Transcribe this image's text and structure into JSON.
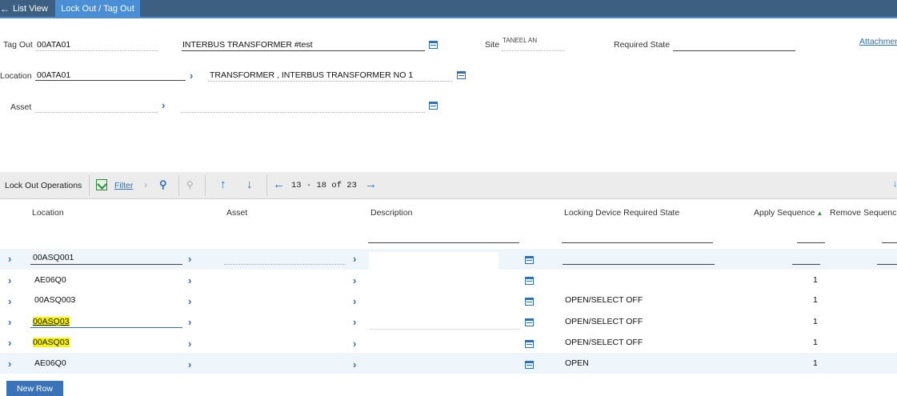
{
  "tabs": {
    "list_view": "List View",
    "active": "Lock Out / Tag Out"
  },
  "header": {
    "tag_out_label": "Tag Out",
    "tag_out_value": "00ATA01",
    "tag_out_desc": "INTERBUS TRANSFORMER #test",
    "site_label": "Site",
    "site_value": "TANEEL AN",
    "required_state_label": "Required State",
    "required_state_value": "",
    "attachments_label": "Attachments",
    "location_label": "Location",
    "location_value": "00ATA01",
    "location_desc": "TRANSFORMER , INTERBUS TRANSFORMER NO 1",
    "asset_label": "Asset",
    "asset_value": "",
    "asset_desc": ""
  },
  "toolbar": {
    "title": "Lock Out Operations",
    "filter_label": "Filter",
    "pager_text": "13 - 18 of 23"
  },
  "table": {
    "columns": {
      "location": "Location",
      "asset": "Asset",
      "description": "Description",
      "required_state": "Locking Device Required State",
      "apply_sequence": "Apply Sequence",
      "remove_sequence": "Remove Sequence"
    },
    "rows": [
      {
        "location": "00ASQ001",
        "state": "",
        "apply": ""
      },
      {
        "location": "AE06Q0",
        "state": "",
        "apply": "1"
      },
      {
        "location": "00ASQ003",
        "state": "OPEN/SELECT OFF",
        "apply": "1"
      },
      {
        "location": "00ASQ03",
        "state": "OPEN/SELECT OFF",
        "apply": "1"
      },
      {
        "location": "00ASQ03",
        "state": "OPEN/SELECT OFF",
        "apply": "1"
      },
      {
        "location": "AE06Q0",
        "state": "OPEN",
        "apply": "1"
      }
    ]
  },
  "new_row_label": "New Row",
  "colors": {
    "topbar": "#3c5f82",
    "active_tab": "#4a8fd6",
    "accent": "#2f6fb5",
    "highlight": "#f6f20a"
  }
}
